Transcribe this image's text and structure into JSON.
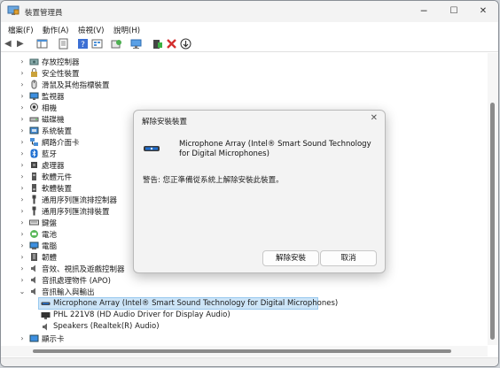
{
  "window": {
    "title": "裝置管理員",
    "icon": "device-manager-icon",
    "controls": {
      "minimize": "─",
      "maximize": "☐",
      "close": "✕"
    }
  },
  "menu": [
    "檔案(F)",
    "動作(A)",
    "檢視(V)",
    "說明(H)"
  ],
  "toolbar": {
    "back": "◀",
    "forward": "▶",
    "tools": [
      "show-hide-tree-icon",
      "properties-icon",
      "help-icon",
      "view-icon",
      "scan-icon",
      "monitor-icon",
      "add-driver-icon",
      "uninstall-icon",
      "update-icon"
    ]
  },
  "tree": [
    {
      "label": "存放控制器",
      "icon": "storage-icon",
      "level": 0,
      "expanded": false
    },
    {
      "label": "安全性裝置",
      "icon": "security-device-icon",
      "level": 0,
      "expanded": false
    },
    {
      "label": "滑鼠及其他指標裝置",
      "icon": "mouse-icon",
      "level": 0,
      "expanded": false
    },
    {
      "label": "監視器",
      "icon": "monitor-icon",
      "level": 0,
      "expanded": false
    },
    {
      "label": "相機",
      "icon": "camera-icon",
      "level": 0,
      "expanded": false
    },
    {
      "label": "磁碟機",
      "icon": "disk-drive-icon",
      "level": 0,
      "expanded": false
    },
    {
      "label": "系統裝置",
      "icon": "system-device-icon",
      "level": 0,
      "expanded": false
    },
    {
      "label": "網路介面卡",
      "icon": "network-adapter-icon",
      "level": 0,
      "expanded": false
    },
    {
      "label": "藍牙",
      "icon": "bluetooth-icon",
      "level": 0,
      "expanded": false
    },
    {
      "label": "處理器",
      "icon": "processor-icon",
      "level": 0,
      "expanded": false
    },
    {
      "label": "軟體元件",
      "icon": "software-component-icon",
      "level": 0,
      "expanded": false
    },
    {
      "label": "軟體裝置",
      "icon": "software-device-icon",
      "level": 0,
      "expanded": false
    },
    {
      "label": "通用序列匯流排控制器",
      "icon": "usb-controller-icon",
      "level": 0,
      "expanded": false
    },
    {
      "label": "通用序列匯流排裝置",
      "icon": "usb-device-icon",
      "level": 0,
      "expanded": false
    },
    {
      "label": "鍵盤",
      "icon": "keyboard-icon",
      "level": 0,
      "expanded": false
    },
    {
      "label": "電池",
      "icon": "battery-icon",
      "level": 0,
      "expanded": false
    },
    {
      "label": "電腦",
      "icon": "computer-icon",
      "level": 0,
      "expanded": false
    },
    {
      "label": "韌體",
      "icon": "firmware-icon",
      "level": 0,
      "expanded": false
    },
    {
      "label": "音效、視訊及遊戲控制器",
      "icon": "sound-controller-icon",
      "level": 0,
      "expanded": false
    },
    {
      "label": "音訊處理物件 (APO)",
      "icon": "audio-processing-icon",
      "level": 0,
      "expanded": false
    },
    {
      "label": "音訊輸入與輸出",
      "icon": "speaker-icon",
      "level": 0,
      "expanded": true
    },
    {
      "label": "Microphone Array (Intel® Smart Sound Technology for Digital Microphones)",
      "icon": "microphone-icon",
      "level": 1,
      "selected": true
    },
    {
      "label": "PHL 221V8 (HD Audio Driver for Display Audio)",
      "icon": "display-audio-icon",
      "level": 1
    },
    {
      "label": "Speakers (Realtek(R) Audio)",
      "icon": "speaker-icon",
      "level": 1
    },
    {
      "label": "顯示卡",
      "icon": "display-adapter-icon",
      "level": 0,
      "expanded": false
    }
  ],
  "dialog": {
    "title": "解除安裝裝置",
    "close": "✕",
    "device_name": "Microphone Array (Intel® Smart Sound Technology for Digital Microphones)",
    "warning": "警告: 您正準備從系統上解除安裝此裝置。",
    "uninstall_button": "解除安裝",
    "cancel_button": "取消"
  },
  "colors": {
    "selection_bg": "#cce4f7",
    "selection_border": "#99c9ef",
    "accent_blue": "#1f6fd1"
  }
}
